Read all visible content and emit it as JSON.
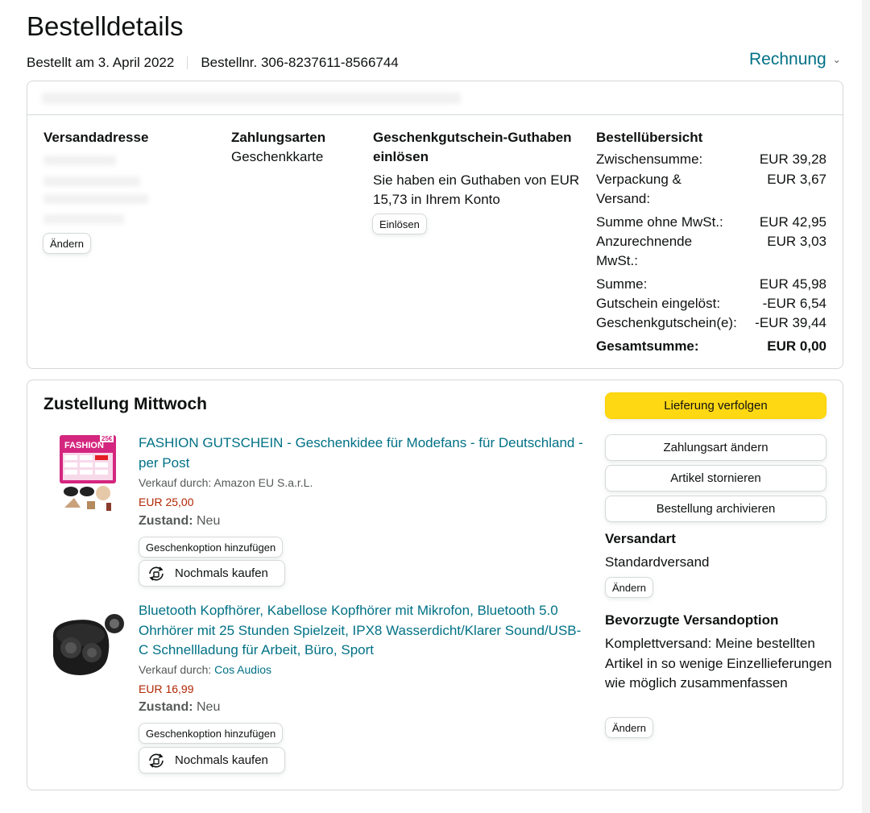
{
  "header": {
    "title": "Bestelldetails",
    "ordered_on": "Bestellt am 3. April 2022",
    "order_number": "Bestellnr. 306-8237611-8566744",
    "invoice_label": "Rechnung"
  },
  "summary_card": {
    "shipping_address": {
      "heading": "Versandadresse",
      "change_label": "Ändern"
    },
    "payment": {
      "heading": "Zahlungsarten",
      "method": "Geschenkkarte"
    },
    "giftcard": {
      "heading": "Geschenkgutschein-Guthaben einlösen",
      "text": "Sie haben ein Guthaben von EUR 15,73 in Ihrem Konto",
      "redeem_label": "Einlösen"
    },
    "overview": {
      "heading": "Bestellübersicht",
      "rows": [
        {
          "label": "Zwischensumme:",
          "value": "EUR 39,28"
        },
        {
          "label": "Verpackung & Versand:",
          "value": "EUR 3,67"
        },
        {
          "label": "Summe ohne MwSt.:",
          "value": "EUR 42,95"
        },
        {
          "label": "Anzurechnende MwSt.:",
          "value": "EUR 3,03"
        },
        {
          "label": "Summe:",
          "value": "EUR 45,98"
        },
        {
          "label": "Gutschein eingelöst:",
          "value": "-EUR 6,54"
        },
        {
          "label": "Geschenkgutschein(e):",
          "value": "-EUR 39,44"
        },
        {
          "label": "Gesamtsumme:",
          "value": "EUR 0,00"
        }
      ]
    }
  },
  "delivery": {
    "title": "Zustellung Mittwoch",
    "actions": {
      "track": "Lieferung verfolgen",
      "change_payment": "Zahlungsart ändern",
      "cancel": "Artikel stornieren",
      "archive": "Bestellung archivieren"
    },
    "shipping_method": {
      "heading": "Versandart",
      "value": "Standardversand",
      "change_label": "Ändern"
    },
    "preferred_option": {
      "heading": "Bevorzugte Versandoption",
      "text": "Komplettversand: Meine bestellten Artikel in so wenige Einzellieferungen wie möglich zusammenfassen",
      "change_label": "Ändern"
    },
    "items": [
      {
        "title": "FASHION GUTSCHEIN - Geschenkidee für Modefans - für Deutschland - per Post",
        "seller_prefix": "Verkauf durch: Amazon EU S.a.r.L.",
        "seller_link": "",
        "price": "EUR 25,00",
        "condition_label": "Zustand:",
        "condition_value": "Neu",
        "gift_option": "Geschenkoption hinzufügen",
        "buy_again": "Nochmals kaufen",
        "thumb_text": "FASHION",
        "thumb_badge": "25€"
      },
      {
        "title": "Bluetooth Kopfhörer, Kabellose Kopfhörer mit Mikrofon, Bluetooth 5.0 Ohrhörer mit 25 Stunden Spielzeit, IPX8 Wasserdicht/Klarer Sound/USB-C Schnellladung für Arbeit, Büro, Sport",
        "seller_prefix": "Verkauf durch:",
        "seller_link": "Cos Audios",
        "price": "EUR 16,99",
        "condition_label": "Zustand:",
        "condition_value": "Neu",
        "gift_option": "Geschenkoption hinzufügen",
        "buy_again": "Nochmals kaufen"
      }
    ]
  },
  "colors": {
    "link": "#007185",
    "price": "#b12704",
    "primary_button": "#ffd814",
    "border": "#d5d9d9"
  }
}
